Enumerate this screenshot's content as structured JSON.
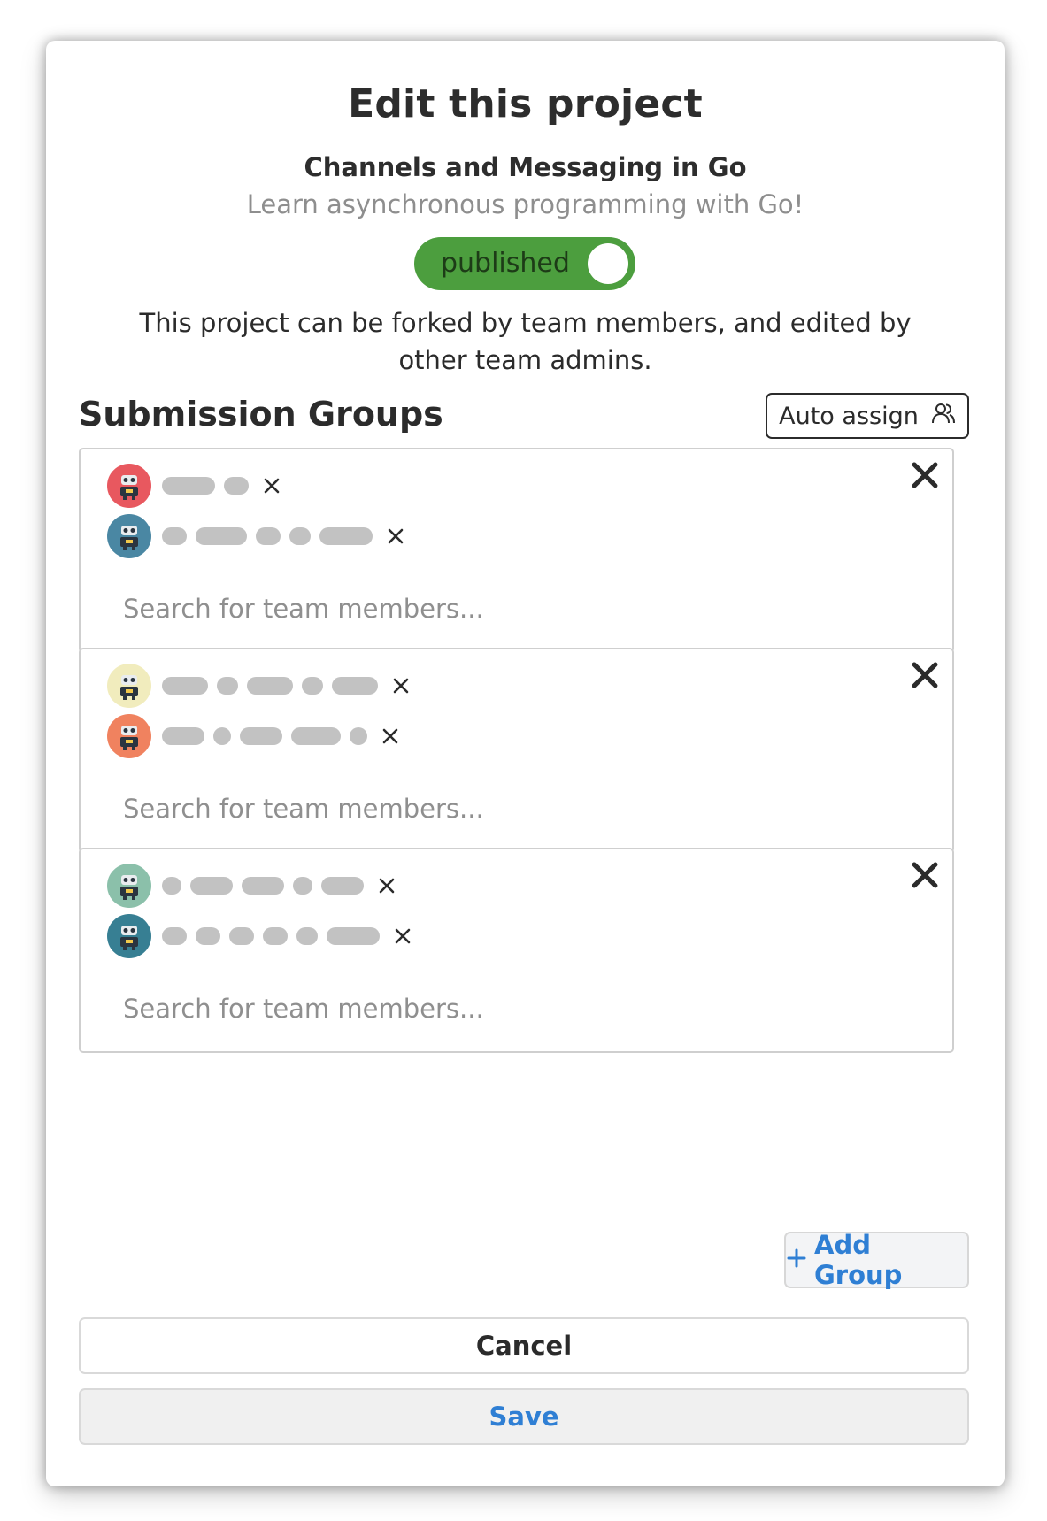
{
  "modal": {
    "title": "Edit this project",
    "project_name": "Channels and Messaging in Go",
    "project_description": "Learn asynchronous programming with Go!",
    "publish_toggle": {
      "label": "published",
      "on": true,
      "color": "#4c9e3e"
    },
    "note": "This project can be forked by team members, and edited by other team admins."
  },
  "submission_groups": {
    "title": "Submission Groups",
    "auto_assign_label": "Auto assign",
    "auto_assign_icon": "users-icon",
    "groups": [
      {
        "members": [
          {
            "avatar_color": "#e8585f",
            "name_pills": [
              60,
              28
            ]
          },
          {
            "avatar_color": "#4a87a3",
            "name_pills": [
              28,
              58,
              28,
              24,
              60
            ]
          }
        ],
        "search_placeholder": "Search for team members..."
      },
      {
        "members": [
          {
            "avatar_color": "#f1ecbd",
            "name_pills": [
              52,
              24,
              52,
              24,
              52
            ]
          },
          {
            "avatar_color": "#f0825f",
            "name_pills": [
              48,
              20,
              48,
              56,
              20
            ]
          }
        ],
        "search_placeholder": "Search for team members..."
      },
      {
        "members": [
          {
            "avatar_color": "#8bc0aa",
            "name_pills": [
              22,
              48,
              48,
              22,
              48
            ]
          },
          {
            "avatar_color": "#377f93",
            "name_pills": [
              28,
              28,
              28,
              28,
              24,
              60
            ]
          }
        ],
        "search_placeholder": "Search for team members..."
      }
    ]
  },
  "actions": {
    "add_group_label": "Add Group",
    "cancel_label": "Cancel",
    "save_label": "Save",
    "accent_color": "#2f7fd4"
  }
}
